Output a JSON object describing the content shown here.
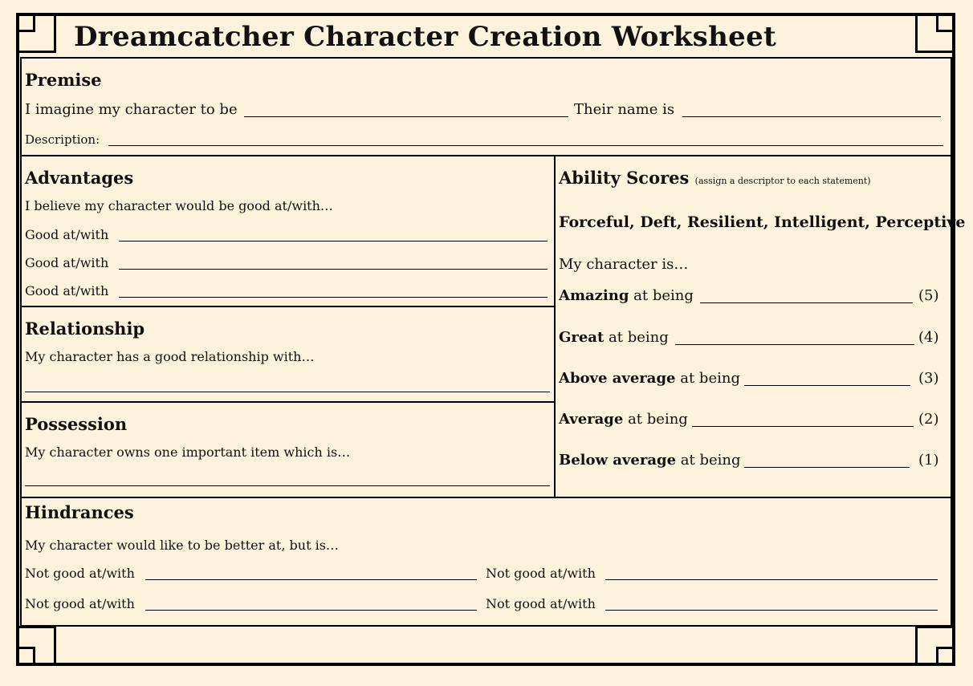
{
  "title": "Dreamcatcher Character Creation Worksheet",
  "premise": {
    "heading": "Premise",
    "imagine_label": "I imagine my character to be",
    "name_label": "Their name is",
    "description_label": "Description:"
  },
  "advantages": {
    "heading": "Advantages",
    "intro": "I believe my character would be good at/with…",
    "rows": [
      "Good at/with",
      "Good at/with",
      "Good at/with"
    ]
  },
  "relationship": {
    "heading": "Relationship",
    "intro": "My character has a good relationship with…"
  },
  "possession": {
    "heading": "Possession",
    "intro": "My character owns one important item which is…"
  },
  "ability": {
    "heading": "Ability Scores",
    "note": "(assign a descriptor to each statement)",
    "descriptors": "Forceful, Deft, Resilient, Intelligent, Perceptive",
    "intro": "My character is…",
    "suffix": "at being",
    "rows": [
      {
        "label": "Amazing",
        "score": "(5)"
      },
      {
        "label": "Great",
        "score": "(4)"
      },
      {
        "label": "Above average",
        "score": "(3)"
      },
      {
        "label": "Average",
        "score": "(2)"
      },
      {
        "label": "Below average",
        "score": "(1)"
      }
    ]
  },
  "hindrances": {
    "heading": "Hindrances",
    "intro": "My character would like to be better at, but is…",
    "rows": [
      "Not good at/with",
      "Not good at/with",
      "Not good at/with",
      "Not good at/with"
    ]
  }
}
